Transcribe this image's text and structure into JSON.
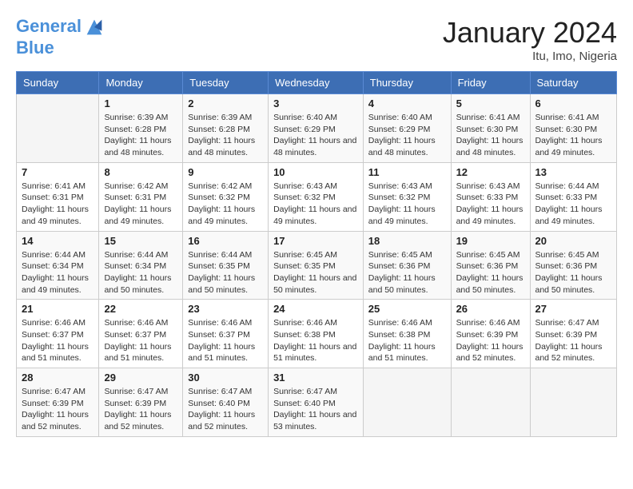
{
  "header": {
    "logo_line1": "General",
    "logo_line2": "Blue",
    "month": "January 2024",
    "location": "Itu, Imo, Nigeria"
  },
  "weekdays": [
    "Sunday",
    "Monday",
    "Tuesday",
    "Wednesday",
    "Thursday",
    "Friday",
    "Saturday"
  ],
  "weeks": [
    [
      {
        "day": "",
        "info": ""
      },
      {
        "day": "1",
        "info": "Sunrise: 6:39 AM\nSunset: 6:28 PM\nDaylight: 11 hours and 48 minutes."
      },
      {
        "day": "2",
        "info": "Sunrise: 6:39 AM\nSunset: 6:28 PM\nDaylight: 11 hours and 48 minutes."
      },
      {
        "day": "3",
        "info": "Sunrise: 6:40 AM\nSunset: 6:29 PM\nDaylight: 11 hours and 48 minutes."
      },
      {
        "day": "4",
        "info": "Sunrise: 6:40 AM\nSunset: 6:29 PM\nDaylight: 11 hours and 48 minutes."
      },
      {
        "day": "5",
        "info": "Sunrise: 6:41 AM\nSunset: 6:30 PM\nDaylight: 11 hours and 48 minutes."
      },
      {
        "day": "6",
        "info": "Sunrise: 6:41 AM\nSunset: 6:30 PM\nDaylight: 11 hours and 49 minutes."
      }
    ],
    [
      {
        "day": "7",
        "info": "Sunrise: 6:41 AM\nSunset: 6:31 PM\nDaylight: 11 hours and 49 minutes."
      },
      {
        "day": "8",
        "info": "Sunrise: 6:42 AM\nSunset: 6:31 PM\nDaylight: 11 hours and 49 minutes."
      },
      {
        "day": "9",
        "info": "Sunrise: 6:42 AM\nSunset: 6:32 PM\nDaylight: 11 hours and 49 minutes."
      },
      {
        "day": "10",
        "info": "Sunrise: 6:43 AM\nSunset: 6:32 PM\nDaylight: 11 hours and 49 minutes."
      },
      {
        "day": "11",
        "info": "Sunrise: 6:43 AM\nSunset: 6:32 PM\nDaylight: 11 hours and 49 minutes."
      },
      {
        "day": "12",
        "info": "Sunrise: 6:43 AM\nSunset: 6:33 PM\nDaylight: 11 hours and 49 minutes."
      },
      {
        "day": "13",
        "info": "Sunrise: 6:44 AM\nSunset: 6:33 PM\nDaylight: 11 hours and 49 minutes."
      }
    ],
    [
      {
        "day": "14",
        "info": "Sunrise: 6:44 AM\nSunset: 6:34 PM\nDaylight: 11 hours and 49 minutes."
      },
      {
        "day": "15",
        "info": "Sunrise: 6:44 AM\nSunset: 6:34 PM\nDaylight: 11 hours and 50 minutes."
      },
      {
        "day": "16",
        "info": "Sunrise: 6:44 AM\nSunset: 6:35 PM\nDaylight: 11 hours and 50 minutes."
      },
      {
        "day": "17",
        "info": "Sunrise: 6:45 AM\nSunset: 6:35 PM\nDaylight: 11 hours and 50 minutes."
      },
      {
        "day": "18",
        "info": "Sunrise: 6:45 AM\nSunset: 6:36 PM\nDaylight: 11 hours and 50 minutes."
      },
      {
        "day": "19",
        "info": "Sunrise: 6:45 AM\nSunset: 6:36 PM\nDaylight: 11 hours and 50 minutes."
      },
      {
        "day": "20",
        "info": "Sunrise: 6:45 AM\nSunset: 6:36 PM\nDaylight: 11 hours and 50 minutes."
      }
    ],
    [
      {
        "day": "21",
        "info": "Sunrise: 6:46 AM\nSunset: 6:37 PM\nDaylight: 11 hours and 51 minutes."
      },
      {
        "day": "22",
        "info": "Sunrise: 6:46 AM\nSunset: 6:37 PM\nDaylight: 11 hours and 51 minutes."
      },
      {
        "day": "23",
        "info": "Sunrise: 6:46 AM\nSunset: 6:37 PM\nDaylight: 11 hours and 51 minutes."
      },
      {
        "day": "24",
        "info": "Sunrise: 6:46 AM\nSunset: 6:38 PM\nDaylight: 11 hours and 51 minutes."
      },
      {
        "day": "25",
        "info": "Sunrise: 6:46 AM\nSunset: 6:38 PM\nDaylight: 11 hours and 51 minutes."
      },
      {
        "day": "26",
        "info": "Sunrise: 6:46 AM\nSunset: 6:39 PM\nDaylight: 11 hours and 52 minutes."
      },
      {
        "day": "27",
        "info": "Sunrise: 6:47 AM\nSunset: 6:39 PM\nDaylight: 11 hours and 52 minutes."
      }
    ],
    [
      {
        "day": "28",
        "info": "Sunrise: 6:47 AM\nSunset: 6:39 PM\nDaylight: 11 hours and 52 minutes."
      },
      {
        "day": "29",
        "info": "Sunrise: 6:47 AM\nSunset: 6:39 PM\nDaylight: 11 hours and 52 minutes."
      },
      {
        "day": "30",
        "info": "Sunrise: 6:47 AM\nSunset: 6:40 PM\nDaylight: 11 hours and 52 minutes."
      },
      {
        "day": "31",
        "info": "Sunrise: 6:47 AM\nSunset: 6:40 PM\nDaylight: 11 hours and 53 minutes."
      },
      {
        "day": "",
        "info": ""
      },
      {
        "day": "",
        "info": ""
      },
      {
        "day": "",
        "info": ""
      }
    ]
  ]
}
